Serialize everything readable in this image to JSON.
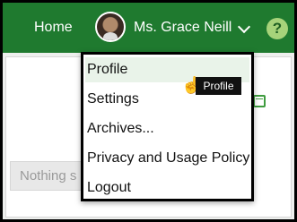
{
  "header": {
    "home_label": "Home",
    "user_name": "Ms. Grace Neill",
    "help_label": "?"
  },
  "content": {
    "empty_message": "Nothing s"
  },
  "menu": {
    "items": [
      {
        "label": "Profile"
      },
      {
        "label": "Settings"
      },
      {
        "label": "Archives..."
      },
      {
        "label": "Privacy and Usage Policy"
      },
      {
        "label": "Logout"
      }
    ]
  },
  "tooltip": {
    "text": "Profile"
  },
  "icons": {
    "avatar": "avatar",
    "dropdown": "chevron-down-icon",
    "help": "help-icon",
    "calendar": "calendar-icon",
    "cursor": "hand-pointer-icon"
  },
  "colors": {
    "header_bg": "#1f7a2f",
    "help_bg": "#a7d37a",
    "menu_hover_bg": "#e9f3e9"
  }
}
